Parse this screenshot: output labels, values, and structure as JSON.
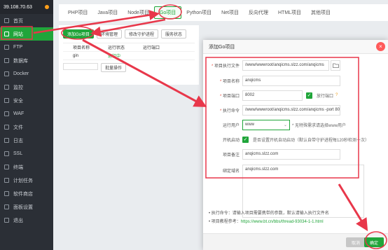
{
  "sidebar": {
    "host": "39.108.70.63",
    "items": [
      {
        "label": "首页"
      },
      {
        "label": "网站"
      },
      {
        "label": "FTP"
      },
      {
        "label": "数据库"
      },
      {
        "label": "Docker"
      },
      {
        "label": "监控"
      },
      {
        "label": "安全"
      },
      {
        "label": "WAF"
      },
      {
        "label": "文件"
      },
      {
        "label": "日志"
      },
      {
        "label": "SSL"
      },
      {
        "label": "终端"
      },
      {
        "label": "计划任务"
      },
      {
        "label": "软件商店"
      },
      {
        "label": "面板设置"
      },
      {
        "label": "退出"
      }
    ]
  },
  "tabs": [
    "PHP项目",
    "Java项目",
    "Node项目",
    "Go项目",
    "Python项目",
    "Net项目",
    "反向代理",
    "HTML项目",
    "其他项目"
  ],
  "panel": {
    "buttons": [
      "添加Go项目",
      "环境管理",
      "修改守护进程",
      "服务状态"
    ],
    "columns": [
      "项目名称",
      "运行状态",
      "运行端口"
    ],
    "row": {
      "name": "gin",
      "status": "运行中"
    },
    "batch_btn": "批量操作"
  },
  "modal": {
    "title": "添加Go项目",
    "fields": {
      "exec_file": {
        "label": "项目执行文件",
        "value": "/www/wwwroot/anqicms.slzz.com/anqicms"
      },
      "name": {
        "label": "项目名称",
        "value": "anqicms"
      },
      "port": {
        "label": "项目端口",
        "value": "8002",
        "checkbox": "放行端口"
      },
      "cmd": {
        "label": "执行命令",
        "value": "/www/wwwroot/anqicms.slzz.com/anqicms -port 8002"
      },
      "user": {
        "label": "运行用户",
        "value": "www",
        "hint": "* 无特殊需求请选择www用户"
      },
      "autostart": {
        "label": "开机启动",
        "text": "是否设置开机自动启动（默认自带守护进程每120秒检测一次）"
      },
      "remark": {
        "label": "项目备注",
        "value": "anqicms.slzz.com"
      },
      "domain": {
        "label": "绑定域名",
        "value": "anqicms.slzz.com"
      }
    },
    "notes": [
      "执行命令：请输入项目需要携带的参数，默认请输入执行文件名",
      "项目教程参考："
    ],
    "note_link": "https://www.bt.cn/bbs/thread-93034-1-1.html",
    "cancel": "取消",
    "confirm": "确定"
  },
  "colors": {
    "accent": "#20a53a",
    "annotation": "#e8374a"
  }
}
